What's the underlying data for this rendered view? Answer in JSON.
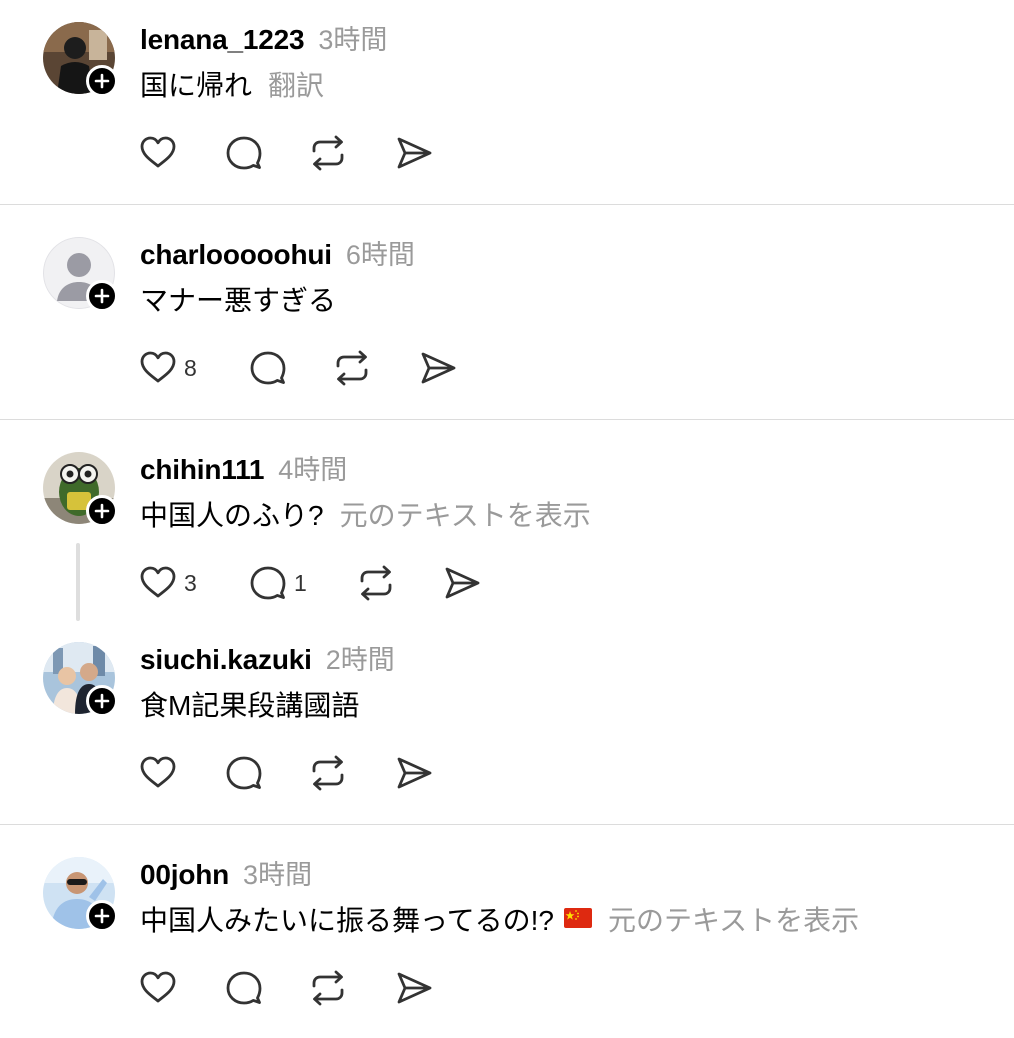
{
  "posts": [
    {
      "username": "lenana_1223",
      "time": "3時間",
      "text": "国に帰れ",
      "secondary": "翻訳",
      "flag": "",
      "likes": "",
      "replies": ""
    },
    {
      "username": "charlooooohui",
      "time": "6時間",
      "text": "マナー悪すぎる",
      "secondary": "",
      "flag": "",
      "likes": "8",
      "replies": ""
    },
    {
      "username": "chihin111",
      "time": "4時間",
      "text": "中国人のふり?",
      "secondary": "元のテキストを表示",
      "flag": "",
      "likes": "3",
      "replies": "1"
    },
    {
      "username": "siuchi.kazuki",
      "time": "2時間",
      "text": "食M記果段講國語",
      "secondary": "",
      "flag": "",
      "likes": "",
      "replies": ""
    },
    {
      "username": "00john",
      "time": "3時間",
      "text": "中国人みたいに振る舞ってるの!?",
      "secondary": "元のテキストを表示",
      "flag": "china-flag",
      "likes": "",
      "replies": ""
    }
  ],
  "icons": {
    "like": "heart-icon",
    "reply": "comment-icon",
    "repost": "repost-icon",
    "share": "send-icon",
    "follow": "plus-icon"
  },
  "colors": {
    "secondary_text": "#9a9a9a",
    "divider": "#dcdcdc",
    "flag_red": "#de2910",
    "flag_yellow": "#ffde00"
  }
}
